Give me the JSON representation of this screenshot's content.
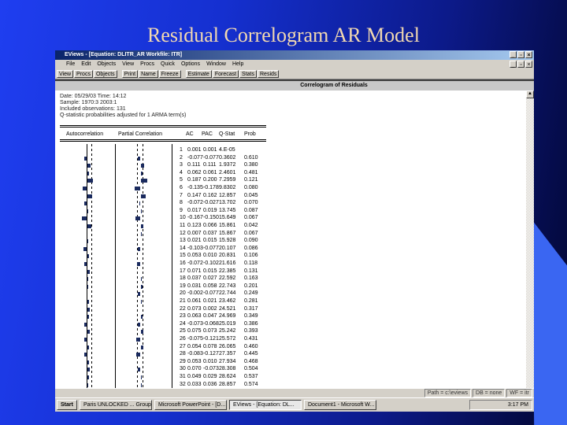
{
  "slide": {
    "title": "Residual Correlogram AR Model"
  },
  "window": {
    "title": "EViews - [Equation: DLITR_AR   Workfile: ITR]",
    "controls": [
      "_",
      "▫",
      "×"
    ],
    "menu": [
      "File",
      "Edit",
      "Objects",
      "View",
      "Procs",
      "Quick",
      "Options",
      "Window",
      "Help"
    ],
    "toolbar": [
      "View",
      "Procs",
      "Objects",
      "Print",
      "Name",
      "Freeze",
      "Estimate",
      "Forecast",
      "Stats",
      "Resids"
    ],
    "band_title": "Correlogram of Residuals"
  },
  "info": [
    "Date: 05/29/03   Time: 14:12",
    "Sample: 1970:3 2003:1",
    "Included observations: 131",
    "Q-statistic probabilities adjusted for 1 ARMA term(s)"
  ],
  "columns": [
    "Autocorrelation",
    "Partial Correlation",
    "AC",
    "PAC",
    "Q-Stat",
    "Prob"
  ],
  "rows": [
    [
      "1",
      "0.001",
      "0.001",
      "4.E-05",
      ""
    ],
    [
      "2",
      "-0.077",
      "-0.077",
      "0.3602",
      "0.610"
    ],
    [
      "3",
      "0.111",
      "0.111",
      "1.9372",
      "0.380"
    ],
    [
      "4",
      "0.062",
      "0.061",
      "2.4601",
      "0.481"
    ],
    [
      "5",
      "0.187",
      "0.200",
      "7.2959",
      "0.121"
    ],
    [
      "6",
      "-0.135",
      "-0.178",
      "9.8302",
      "0.080"
    ],
    [
      "7",
      "0.147",
      "0.162",
      "12.857",
      "0.045"
    ],
    [
      "8",
      "-0.072",
      "-0.027",
      "13.702",
      "0.070"
    ],
    [
      "9",
      "0.017",
      "0.019",
      "13.745",
      "0.087"
    ],
    [
      "10",
      "-0.167",
      "-0.150",
      "15.649",
      "0.067"
    ],
    [
      "11",
      "0.123",
      "0.066",
      "15.861",
      "0.042"
    ],
    [
      "12",
      "0.007",
      "0.037",
      "15.867",
      "0.067"
    ],
    [
      "13",
      "0.021",
      "0.015",
      "15.928",
      "0.090"
    ],
    [
      "14",
      "-0.103",
      "-0.077",
      "20.107",
      "0.086"
    ],
    [
      "15",
      "0.053",
      "0.010",
      "20.831",
      "0.106"
    ],
    [
      "16",
      "-0.072",
      "-0.102",
      "21.616",
      "0.118"
    ],
    [
      "17",
      "0.071",
      "0.015",
      "22.385",
      "0.131"
    ],
    [
      "18",
      "0.037",
      "0.027",
      "22.592",
      "0.163"
    ],
    [
      "19",
      "0.031",
      "0.058",
      "22.743",
      "0.201"
    ],
    [
      "20",
      "-0.002",
      "-0.077",
      "22.744",
      "0.249"
    ],
    [
      "21",
      "0.061",
      "0.021",
      "23.462",
      "0.281"
    ],
    [
      "22",
      "0.073",
      "0.002",
      "24.521",
      "0.317"
    ],
    [
      "23",
      "0.063",
      "0.047",
      "24.969",
      "0.349"
    ],
    [
      "24",
      "-0.073",
      "-0.068",
      "25.019",
      "0.386"
    ],
    [
      "25",
      "0.075",
      "0.073",
      "25.242",
      "0.393"
    ],
    [
      "26",
      "-0.075",
      "-0.121",
      "25.572",
      "0.431"
    ],
    [
      "27",
      "0.054",
      "0.078",
      "26.065",
      "0.460"
    ],
    [
      "28",
      "-0.083",
      "-0.127",
      "27.357",
      "0.445"
    ],
    [
      "29",
      "0.053",
      "0.010",
      "27.934",
      "0.468"
    ],
    [
      "30",
      "0.070",
      "-0.073",
      "28.308",
      "0.504"
    ],
    [
      "31",
      "0.049",
      "0.029",
      "28.624",
      "0.537"
    ],
    [
      "32",
      "0.033",
      "0.036",
      "28.857",
      "0.574"
    ]
  ],
  "status": [
    "Path = c:\\eviews",
    "DB = none",
    "WF = itr"
  ],
  "taskbar": {
    "start": "Start",
    "items": [
      "Paris UNLOCKED ... Group",
      "Microsoft PowerPoint - [D...",
      "EViews - [Equation: DL...",
      "Document1 - Microsoft W..."
    ],
    "clock": "3:17 PM"
  },
  "colors": {
    "bar": "#1a2a5e",
    "title": "#f2d9b0"
  }
}
